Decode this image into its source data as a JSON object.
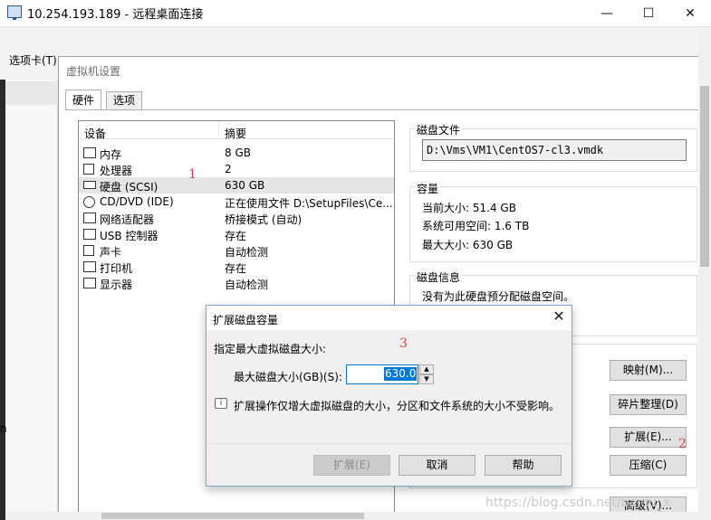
{
  "rdp": {
    "title": "10.254.193.189 - 远程桌面连接",
    "minimize": "—",
    "maximize": "☐",
    "close": "✕"
  },
  "host": {
    "tab_label": "选项卡(T)",
    "left_side_char": "n"
  },
  "vm_settings": {
    "title": "虚拟机设置",
    "tabs": [
      {
        "label": "硬件"
      },
      {
        "label": "选项"
      }
    ],
    "columns": {
      "device": "设备",
      "summary": "摘要"
    },
    "devices": [
      {
        "name": "内存",
        "summary": "8 GB",
        "icon": "memory-icon"
      },
      {
        "name": "处理器",
        "summary": "2",
        "icon": "cpu-icon"
      },
      {
        "name": "硬盘 (SCSI)",
        "summary": "630 GB",
        "icon": "hard-disk-icon",
        "selected": true
      },
      {
        "name": "CD/DVD (IDE)",
        "summary": "正在使用文件 D:\\SetupFiles\\Ce...",
        "icon": "cd-dvd-icon"
      },
      {
        "name": "网络适配器",
        "summary": "桥接模式 (自动)",
        "icon": "network-adapter-icon"
      },
      {
        "name": "USB 控制器",
        "summary": "存在",
        "icon": "usb-controller-icon"
      },
      {
        "name": "声卡",
        "summary": "自动检测",
        "icon": "sound-card-icon"
      },
      {
        "name": "打印机",
        "summary": "存在",
        "icon": "printer-icon"
      },
      {
        "name": "显示器",
        "summary": "自动检测",
        "icon": "display-icon"
      }
    ],
    "disk_file": {
      "title": "磁盘文件",
      "path": "D:\\Vms\\VM1\\CentOS7-cl3.vmdk"
    },
    "capacity": {
      "title": "容量",
      "current_size": "当前大小: 51.4 GB",
      "system_free": "系统可用空间: 1.6 TB",
      "max_size": "最大大小: 630 GB"
    },
    "disk_info": {
      "title": "磁盘信息",
      "text": "没有为此硬盘预分配磁盘空间。"
    },
    "buttons": {
      "map": "映射(M)...",
      "defrag": "碎片整理(D)",
      "expand": "扩展(E)...",
      "compact": "压缩(C)",
      "advanced": "高级(V)..."
    }
  },
  "annotations": {
    "one": "1",
    "two": "2",
    "three": "3"
  },
  "expand_dialog": {
    "title": "扩展磁盘容量",
    "close": "✕",
    "prompt": "指定最大虚拟磁盘大小:",
    "field_label": "最大磁盘大小(GB)(S):",
    "field_value": "630.0",
    "info": "扩展操作仅增大虚拟磁盘的大小，分区和文件系统的大小不受影响。",
    "info_icon_glyph": "i",
    "buttons": {
      "expand": "扩展(E)",
      "cancel": "取消",
      "help": "帮助"
    }
  },
  "watermark": "https://blog.csdn.net/baidu_x"
}
